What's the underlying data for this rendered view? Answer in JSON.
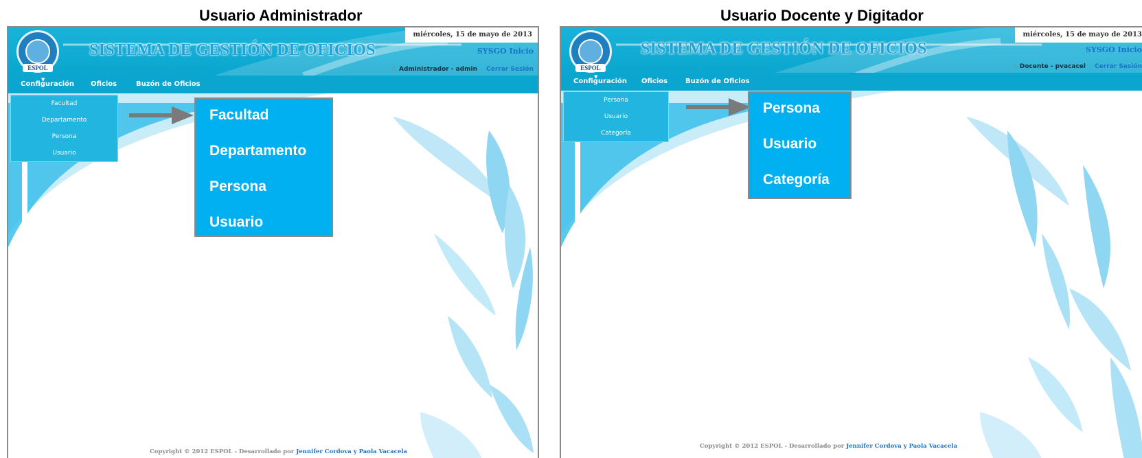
{
  "panels": [
    {
      "caption": "Usuario Administrador",
      "app": {
        "title": "SISTEMA DE GESTIÓN DE OFICIOS",
        "date": "miércoles, 15 de mayo de 2013",
        "home_link": "SYSGO Inicio",
        "user": "Administrador - admin",
        "logout": "Cerrar Sesión",
        "logo_text": "ESPOL"
      },
      "menu": [
        "Configuración",
        "Oficios",
        "Buzón de Oficios"
      ],
      "dropdown": [
        "Facultad",
        "Departamento",
        "Persona",
        "Usuario"
      ],
      "callout": [
        "Facultad",
        "Departamento",
        "Persona",
        "Usuario"
      ],
      "footer": {
        "text": "Copyright © 2012 ESPOL - Desarrollado por",
        "authors": "Jennifer Cordova y Paola Vacacela"
      }
    },
    {
      "caption": "Usuario Docente y Digitador",
      "app": {
        "title": "SISTEMA DE GESTIÓN DE OFICIOS",
        "date": "miércoles, 15 de mayo de 2013",
        "home_link": "SYSGO Inicio",
        "user": "Docente - pvacacel",
        "logout": "Cerrar Sesión",
        "logo_text": "ESPOL"
      },
      "menu": [
        "Configuración",
        "Oficios",
        "Buzón de Oficios"
      ],
      "dropdown": [
        "Persona",
        "Usuario",
        "Categoría"
      ],
      "callout": [
        "Persona",
        "Usuario",
        "Categoría"
      ],
      "footer": {
        "text": "Copyright © 2012 ESPOL - Desarrollado por",
        "authors": "Jennifer Cordova y Paola Vacacela"
      }
    }
  ],
  "colors": {
    "header": "#0aa6cf",
    "dropdown": "#22b5e0",
    "callout": "#00b0f0",
    "link": "#1a73c9",
    "arrow": "#7a7a7a"
  }
}
